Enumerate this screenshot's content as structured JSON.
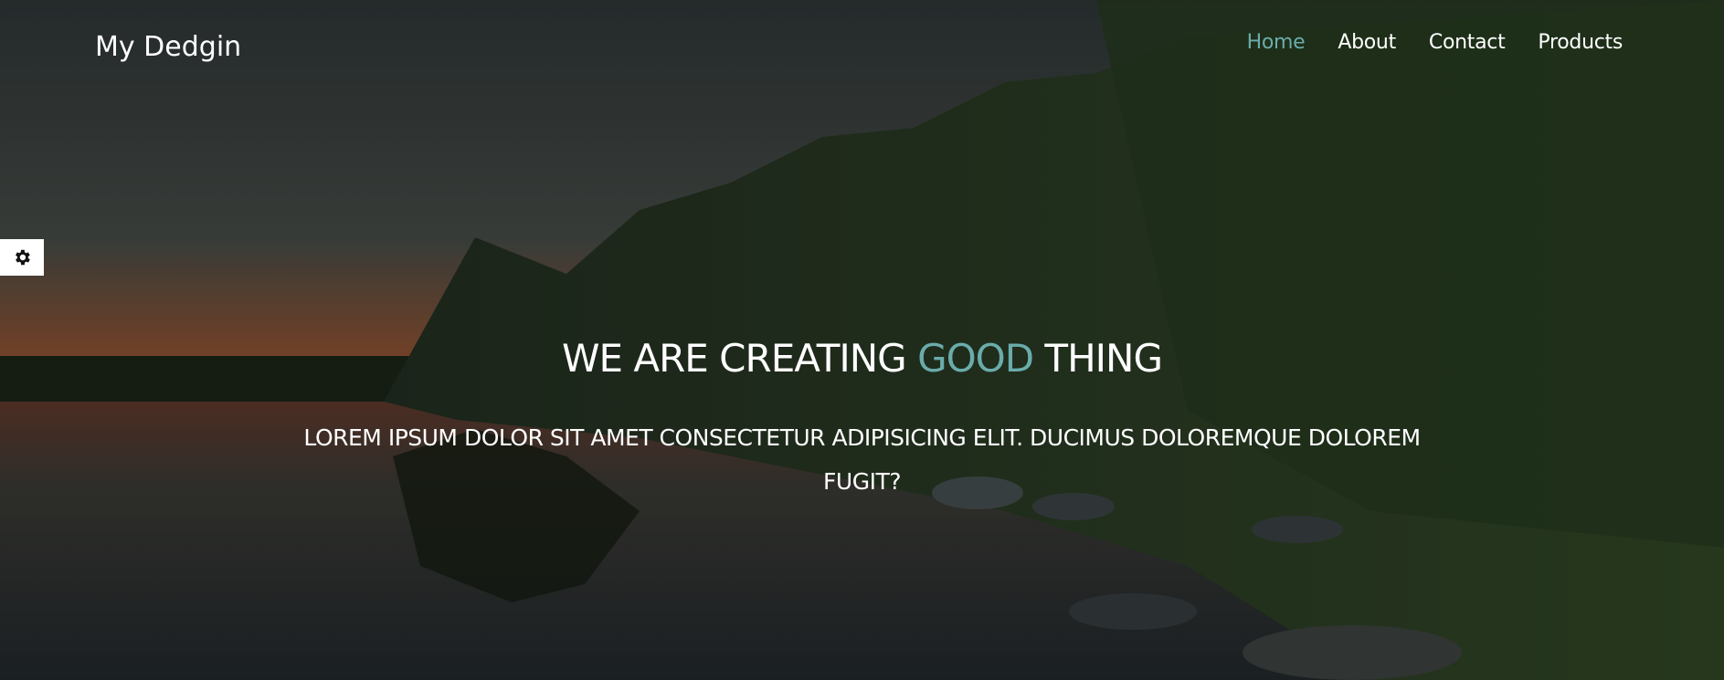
{
  "header": {
    "brand": "My Dedgin",
    "nav": [
      {
        "label": "Home",
        "active": true
      },
      {
        "label": "About",
        "active": false
      },
      {
        "label": "Contact",
        "active": false
      },
      {
        "label": "Products",
        "active": false
      }
    ]
  },
  "settings": {
    "icon": "gear-icon"
  },
  "hero": {
    "title_part1": "WE ARE CREATING ",
    "title_accent": "GOOD",
    "title_part2": " THING",
    "subtitle": "LOREM IPSUM DOLOR SIT AMET CONSECTETUR ADIPISICING ELIT. DUCIMUS DOLOREMQUE DOLOREM FUGIT?"
  },
  "colors": {
    "accent": "#6aacab",
    "text": "#ffffff"
  }
}
